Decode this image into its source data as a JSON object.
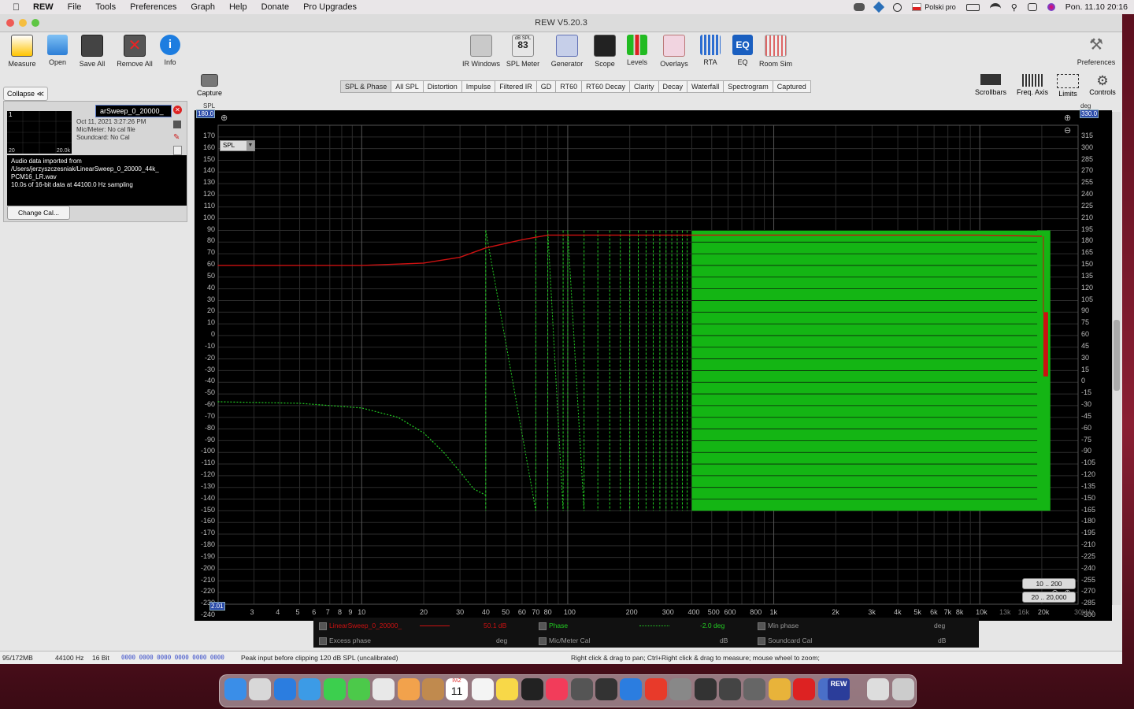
{
  "menubar": {
    "app": "REW",
    "items": [
      "File",
      "Tools",
      "Preferences",
      "Graph",
      "Help",
      "Donate",
      "Pro Upgrades"
    ],
    "input_source": "Polski pro",
    "datetime": "Pon. 11.10  20:16"
  },
  "window": {
    "title": "REW V5.20.3"
  },
  "toolbar": {
    "left": [
      "Measure",
      "Open",
      "Save All",
      "Remove All",
      "Info"
    ],
    "center": [
      "IR Windows",
      "SPL Meter",
      "Generator",
      "Scope",
      "Levels",
      "Overlays",
      "RTA",
      "EQ",
      "Room Sim"
    ],
    "spl_meter_value": "83",
    "spl_meter_unit": "dB SPL",
    "right": "Preferences"
  },
  "left_panel": {
    "collapse": "Collapse",
    "measurement_name": "arSweep_0_20000_",
    "index": "1",
    "thumb_left": "20",
    "thumb_right": "20.0k",
    "date": "Oct 11, 2021 3:27:26 PM",
    "mic": "Mic/Meter: No cal file",
    "soundcard": "Soundcard: No Cal",
    "desc": [
      "Audio data imported from",
      "/Users/jerzyszczesniak/LinearSweep_0_20000_44k_",
      "PCM16_LR.wav",
      "10.0s of 16-bit data at 44100.0 Hz sampling"
    ],
    "change_cal": "Change Cal..."
  },
  "capture": "Capture",
  "tabs": [
    "SPL & Phase",
    "All SPL",
    "Distortion",
    "Impulse",
    "Filtered IR",
    "GD",
    "RT60",
    "RT60 Decay",
    "Clarity",
    "Decay",
    "Waterfall",
    "Spectrogram",
    "Captured"
  ],
  "view_controls": [
    "Scrollbars",
    "Freq. Axis",
    "Limits",
    "Controls"
  ],
  "graph": {
    "left_axis_title": "SPL",
    "right_axis_title": "deg",
    "left_top": "180.0",
    "right_top": "330.0",
    "x_start": "2.01",
    "spl_select": "SPL",
    "left_ticks": [
      "170",
      "160",
      "150",
      "140",
      "130",
      "120",
      "110",
      "100",
      "90",
      "80",
      "70",
      "60",
      "50",
      "40",
      "30",
      "20",
      "10",
      "0",
      "-10",
      "-20",
      "-30",
      "-40",
      "-50",
      "-60",
      "-70",
      "-80",
      "-90",
      "-100",
      "-110",
      "-120",
      "-130",
      "-140",
      "-150",
      "-160",
      "-170",
      "-180",
      "-190",
      "-200",
      "-210",
      "-220",
      "-230",
      "-240"
    ],
    "right_ticks": [
      "315",
      "300",
      "285",
      "270",
      "255",
      "240",
      "225",
      "210",
      "195",
      "180",
      "165",
      "150",
      "135",
      "120",
      "105",
      "90",
      "75",
      "60",
      "45",
      "30",
      "15",
      "0",
      "-15",
      "-30",
      "-45",
      "-60",
      "-75",
      "-90",
      "-105",
      "-120",
      "-135",
      "-150",
      "-165",
      "-180",
      "-195",
      "-210",
      "-225",
      "-240",
      "-255",
      "-270",
      "-285",
      "-300"
    ],
    "x_ticks": [
      "3",
      "4",
      "5",
      "6",
      "7",
      "8",
      "9",
      "10",
      "20",
      "30",
      "40",
      "50",
      "60",
      "70",
      "80",
      "100",
      "200",
      "300",
      "400",
      "500",
      "600",
      "800",
      "1k",
      "2k",
      "3k",
      "4k",
      "5k",
      "6k",
      "7k",
      "8k",
      "10k",
      "13k",
      "16k",
      "20k",
      "30kHz"
    ],
    "zoom_buttons": [
      "10 .. 200",
      "20 .. 20,000"
    ]
  },
  "chart_data": {
    "type": "line",
    "x_scale": "log",
    "xlim": [
      2.01,
      30000
    ],
    "ylim": [
      -240,
      180
    ],
    "y2lim": [
      -300,
      330
    ],
    "series": [
      {
        "name": "LinearSweep_0_20000_",
        "axis": "SPL",
        "x": [
          2,
          10,
          20,
          30,
          40,
          60,
          80,
          100,
          1000,
          10000,
          20000
        ],
        "values": [
          50,
          50,
          52,
          57,
          65,
          72,
          76,
          76,
          76,
          76,
          75
        ]
      },
      {
        "name": "Phase",
        "axis": "deg",
        "x": [
          2,
          5,
          10,
          15,
          20,
          25,
          30,
          35,
          40
        ],
        "values": [
          -40,
          -42,
          -48,
          -60,
          -80,
          -105,
          -130,
          -152,
          -160
        ]
      }
    ]
  },
  "legend": {
    "rows": [
      {
        "name": "LinearSweep_0_20000_",
        "value": "50.1 dB",
        "color": "#cc1111"
      },
      {
        "name": "Phase",
        "value": "-2.0 deg",
        "color": "#22cc22"
      },
      {
        "name": "Min phase",
        "unit": "deg"
      },
      {
        "name": "Excess phase",
        "unit": "deg"
      },
      {
        "name": "Mic/Meter Cal",
        "unit": "dB"
      },
      {
        "name": "Soundcard Cal",
        "unit": "dB"
      }
    ]
  },
  "status": {
    "memory": "95/172MB",
    "rate": "44100 Hz",
    "bits": "16 Bit",
    "meters": "0000 0000  0000 0000  0000 0000",
    "peak": "Peak input before clipping 120 dB SPL (uncalibrated)",
    "hint": "Right click & drag to pan; Ctrl+Right click & drag to measure; mouse wheel to zoom;"
  },
  "dock": {
    "calendar_month": "PAŹ",
    "calendar_day": "11",
    "rew_label": "REW"
  }
}
